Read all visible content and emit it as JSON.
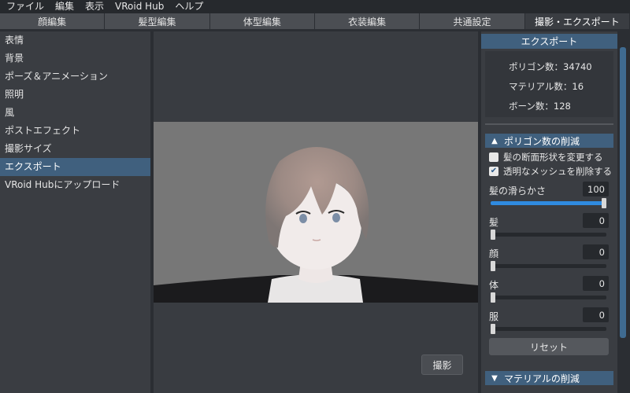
{
  "menubar": [
    "ファイル",
    "編集",
    "表示",
    "VRoid Hub",
    "ヘルプ"
  ],
  "tabs": [
    {
      "label": "顔編集",
      "active": false
    },
    {
      "label": "髪型編集",
      "active": false
    },
    {
      "label": "体型編集",
      "active": false
    },
    {
      "label": "衣装編集",
      "active": false
    },
    {
      "label": "共通設定",
      "active": false
    },
    {
      "label": "撮影・エクスポート",
      "active": true
    }
  ],
  "sidebar": {
    "items": [
      "表情",
      "背景",
      "ポーズ＆アニメーション",
      "照明",
      "風",
      "ポストエフェクト",
      "撮影サイズ",
      "エクスポート",
      "VRoid Hubにアップロード"
    ],
    "active_index": 7
  },
  "viewport": {
    "shoot_label": "撮影"
  },
  "export_panel": {
    "header": "エクスポート",
    "stats": {
      "polygons": "ポリゴン数：34740",
      "materials": "マテリアル数：16",
      "bones": "ボーン数：128"
    },
    "polygon_reduction": {
      "header": "ポリゴン数の削減",
      "checkboxes": [
        {
          "label": "髪の断面形状を変更する",
          "checked": false
        },
        {
          "label": "透明なメッシュを削除する",
          "checked": true
        }
      ],
      "sliders": [
        {
          "label": "髪の滑らかさ",
          "value": "100",
          "fraction": 1.0
        },
        {
          "label": "髪",
          "value": "0",
          "fraction": 0.0
        },
        {
          "label": "顔",
          "value": "0",
          "fraction": 0.0
        },
        {
          "label": "体",
          "value": "0",
          "fraction": 0.0
        },
        {
          "label": "服",
          "value": "0",
          "fraction": 0.0
        }
      ],
      "reset_label": "リセット"
    },
    "material_reduction": {
      "header": "マテリアルの削減"
    }
  },
  "colors": {
    "accent": "#40607e",
    "slider_fill": "#2f8be0",
    "panel": "#3a3d42",
    "background": "#2b2e33"
  }
}
